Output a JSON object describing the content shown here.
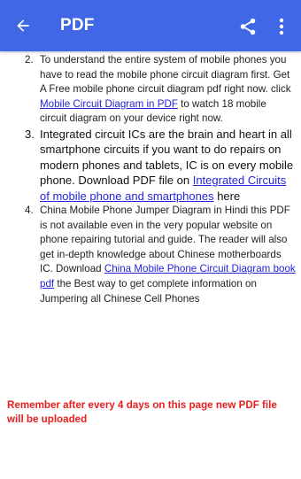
{
  "appbar": {
    "title": "PDF",
    "back_icon": "arrow-left-icon",
    "share_icon": "share-icon",
    "menu_icon": "more-vert-icon",
    "background": "#3f67e6"
  },
  "items": [
    {
      "number": "2.",
      "text_before": "To understand the entire system of mobile phones you have to read the mobile phone circuit diagram first. Get A Free mobile phone circuit diagram pdf right now. click ",
      "link": "Mobile Circuit Diagram in PDF",
      "text_after": " to watch 18 mobile circuit diagram on your device right now."
    },
    {
      "number": "3.",
      "text_before": "Integrated circuit ICs are the brain and heart in all smartphone circuits if you want to do repairs on modern phones and tablets, IC is on every mobile phone. Download PDF file on ",
      "link": "Integrated Circuits of mobile phone and smartphones",
      "text_after": " here"
    },
    {
      "number": "4.",
      "text_before": "China Mobile Phone Jumper Diagram in Hindi this PDF is not available even in the very popular website on phone repairing tutorial and guide. The reader will also get in-depth knowledge about Chinese motherboards IC. Download ",
      "link": "China Mobile Phone Circuit Diagram book pdf",
      "text_after": " the Best way to get complete information on Jumpering all Chinese Cell Phones"
    }
  ],
  "notice": "Remember after every 4 days on this page new PDF file will be uploaded",
  "colors": {
    "link": "#2424d8",
    "notice": "#e81e1e"
  }
}
